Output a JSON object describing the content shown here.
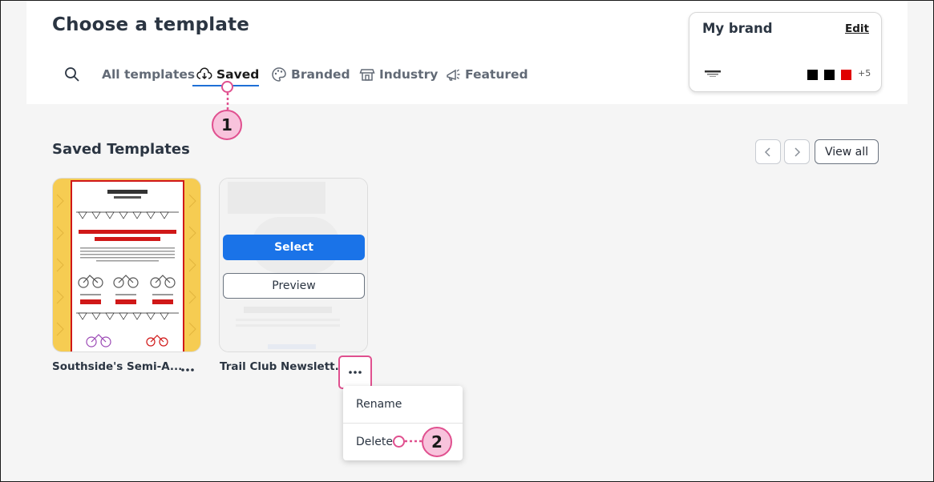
{
  "header": {
    "title": "Choose a template",
    "tabs": [
      {
        "label": "All templates",
        "icon": "search-icon"
      },
      {
        "label": "Saved",
        "icon": "cloud-download-icon",
        "active": true
      },
      {
        "label": "Branded",
        "icon": "palette-icon"
      },
      {
        "label": "Industry",
        "icon": "storefront-icon"
      },
      {
        "label": "Featured",
        "icon": "megaphone-icon"
      }
    ]
  },
  "brand": {
    "title": "My brand",
    "edit_label": "Edit",
    "colors": [
      "#000000",
      "#000000",
      "#e00000"
    ],
    "more_colors": "+5"
  },
  "section": {
    "title": "Saved Templates",
    "view_all_label": "View all"
  },
  "cards": [
    {
      "name": "Southside's Semi-A..."
    },
    {
      "name": "Trail Club Newslett...",
      "select_label": "Select",
      "preview_label": "Preview"
    }
  ],
  "menu": {
    "items": [
      "Rename",
      "Delete"
    ]
  },
  "callouts": [
    "1",
    "2"
  ],
  "colors": {
    "accent": "#1a73e8",
    "callout": "#e0508f",
    "callout_fill": "#f8c3dc"
  }
}
